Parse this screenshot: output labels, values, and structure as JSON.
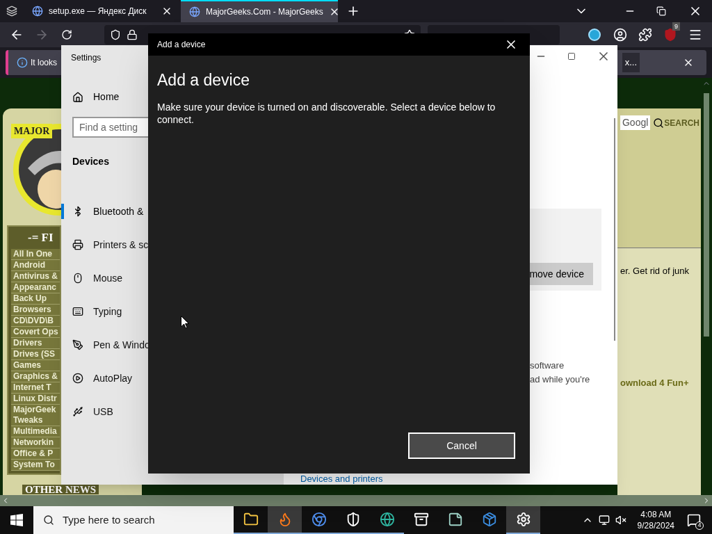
{
  "browser": {
    "tabs": [
      {
        "title": "setup.exe — Яндекс Диск",
        "selected": false
      },
      {
        "title": "MajorGeeks.Com - MajorGeeks",
        "selected": true
      }
    ],
    "extension_badge": "9",
    "notification": {
      "text": "It looks",
      "button": "x..."
    }
  },
  "website": {
    "logo_text": "MAJOR",
    "categories_header": "-= FI",
    "categories": [
      "All In One",
      "Android",
      "Antivirus &",
      "Appearanc",
      "Back Up",
      "Browsers",
      "CD\\DVD\\B",
      "Covert Ops",
      "Drivers",
      "Drives (SS",
      "Games",
      "Graphics &",
      "Internet T",
      "Linux Distr",
      "MajorGeek\nTweaks",
      "Multimedia",
      "Networkin",
      "Office & P",
      "System To"
    ],
    "other_news": "OTHER NEWS",
    "search_field": "Googl",
    "search_button": "SEARCH",
    "snippet": "er. Get rid of junk",
    "link": "ownload 4 Fun+"
  },
  "settings_window": {
    "title": "Settings",
    "home": "Home",
    "search_placeholder": "Find a setting",
    "section": "Devices",
    "nav": [
      {
        "kind": "bluetooth",
        "label": "Bluetooth &",
        "selected": true
      },
      {
        "kind": "printer",
        "label": "Printers & sc",
        "selected": false
      },
      {
        "kind": "mouse",
        "label": "Mouse",
        "selected": false
      },
      {
        "kind": "typing",
        "label": "Typing",
        "selected": false
      },
      {
        "kind": "pen",
        "label": "Pen & Windo",
        "selected": false
      },
      {
        "kind": "autoplay",
        "label": "AutoPlay",
        "selected": false
      },
      {
        "kind": "usb",
        "label": "USB",
        "selected": false
      }
    ],
    "remove_button": "move device",
    "text_lines": [
      "software",
      "ad while you're"
    ],
    "link": "Devices and printers"
  },
  "dialog": {
    "title": "Add a device",
    "heading": "Add a device",
    "message": "Make sure your device is turned on and discoverable. Select a device below to connect.",
    "cancel": "Cancel"
  },
  "taskbar": {
    "search_placeholder": "Type here to search",
    "apps": [
      {
        "kind": "files",
        "running": true,
        "active": false
      },
      {
        "kind": "firefox",
        "running": true,
        "active": true
      },
      {
        "kind": "browser",
        "running": true,
        "active": false
      },
      {
        "kind": "security",
        "running": true,
        "active": false
      },
      {
        "kind": "edge",
        "running": true,
        "active": false
      },
      {
        "kind": "archiver",
        "running": false,
        "active": false
      },
      {
        "kind": "notepad",
        "running": false,
        "active": false
      },
      {
        "kind": "installer",
        "running": false,
        "active": false
      },
      {
        "kind": "settings",
        "running": true,
        "active": true
      }
    ],
    "time": "4:08 AM",
    "date": "9/28/2024",
    "notifications": "4"
  }
}
